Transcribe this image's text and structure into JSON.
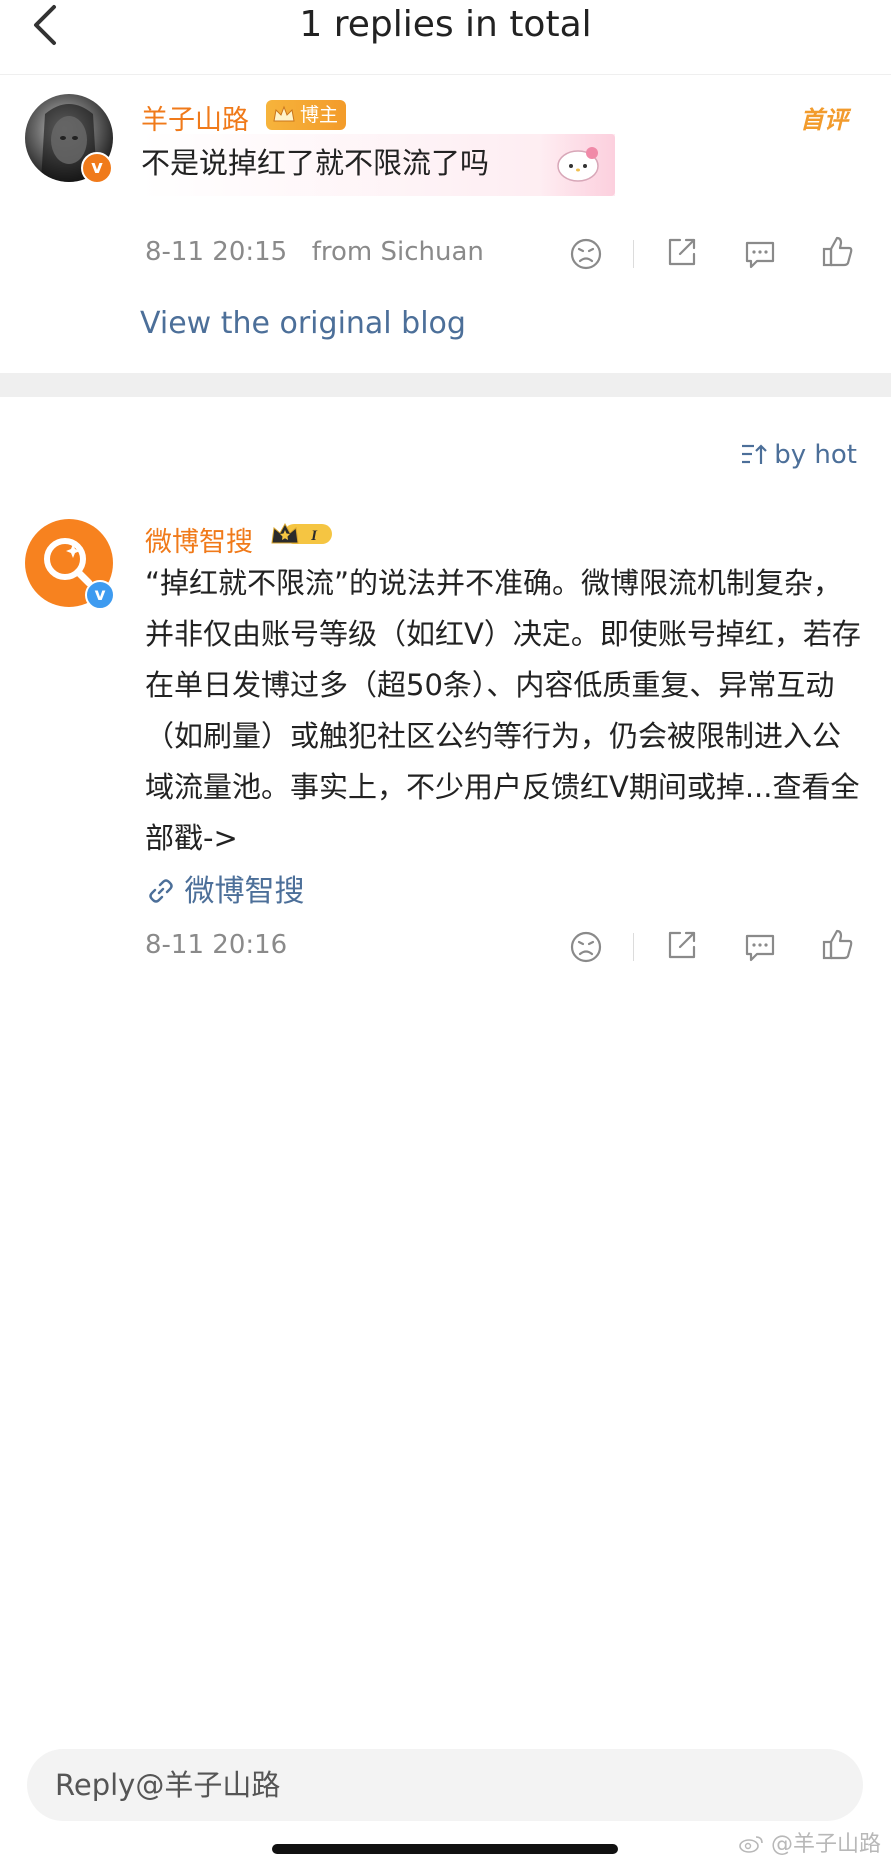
{
  "header": {
    "title": "1 replies in total"
  },
  "main_comment": {
    "username": "羊子山路",
    "badge": "博主",
    "first_comment_tag": "首评",
    "text": "不是说掉红了就不限流了吗",
    "time": "8-11 20:15",
    "location": "from Sichuan",
    "view_original": "View the original blog"
  },
  "sort": {
    "label": "by hot"
  },
  "reply": {
    "username": "微博智搜",
    "level": "I",
    "text": "“掉红就不限流”的说法并不准确。微博限流机制复杂，并非仅由账号等级（如红V）决定。即使账号掉红，若存在单日发博过多（超50条）、内容低质重复、异常互动（如刷量）或触犯社区公约等行为，仍会被限制进入公域流量池。事实上，不少用户反馈红V期间或掉...查看全部戳->",
    "source_link": "微博智搜",
    "time": "8-11 20:16"
  },
  "reply_bar": {
    "placeholder": "Reply@羊子山路"
  },
  "watermark": "@羊子山路",
  "colors": {
    "username_orange": "#f07a1a",
    "link_blue": "#4c6f99",
    "avatar_orange": "#f7821f",
    "verified_orange": "#f07a1a",
    "verified_blue": "#3e9bf0"
  },
  "icons": {
    "back": "chevron-left-icon",
    "dislike": "frown-face-icon",
    "share": "share-icon",
    "comment": "comment-icon",
    "like": "thumbs-up-icon",
    "sort": "sort-icon",
    "link": "link-icon"
  }
}
